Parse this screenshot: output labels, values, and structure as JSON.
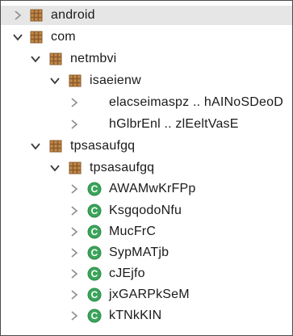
{
  "tree": {
    "nodes": [
      {
        "label": "android",
        "kind": "package",
        "state": "collapsed",
        "depth": 0,
        "selected": true
      },
      {
        "label": "com",
        "kind": "package",
        "state": "expanded",
        "depth": 0
      },
      {
        "label": "netmbvi",
        "kind": "package",
        "state": "expanded",
        "depth": 1
      },
      {
        "label": "isaeienw",
        "kind": "package",
        "state": "expanded",
        "depth": 2
      },
      {
        "label": "elacseimaspz .. hAINoSDeoD",
        "kind": "folder",
        "state": "collapsed",
        "depth": 3
      },
      {
        "label": "hGlbrEnl .. zlEeltVasE",
        "kind": "folder",
        "state": "collapsed",
        "depth": 3
      },
      {
        "label": "tpsasaufgq",
        "kind": "package",
        "state": "expanded",
        "depth": 1
      },
      {
        "label": "tpsasaufgq",
        "kind": "package",
        "state": "expanded",
        "depth": 2
      },
      {
        "label": "AWAMwKrFPp",
        "kind": "class",
        "state": "collapsed",
        "depth": 3
      },
      {
        "label": "KsgqodoNfu",
        "kind": "class",
        "state": "collapsed",
        "depth": 3
      },
      {
        "label": "MucFrC",
        "kind": "class",
        "state": "collapsed",
        "depth": 3
      },
      {
        "label": "SypMATjb",
        "kind": "class",
        "state": "collapsed",
        "depth": 3
      },
      {
        "label": "cJEjfo",
        "kind": "class",
        "state": "collapsed",
        "depth": 3
      },
      {
        "label": "jxGARPkSeM",
        "kind": "class",
        "state": "collapsed",
        "depth": 3
      },
      {
        "label": "kTNkKIN",
        "kind": "class",
        "state": "collapsed",
        "depth": 3
      }
    ]
  },
  "icons": {
    "package_icon": "package-icon",
    "class_icon": "class-icon",
    "expanded_arrow": "chevron-down-icon",
    "collapsed_arrow": "chevron-right-icon"
  },
  "colors": {
    "package_brown": "#8a5a2b",
    "class_green": "#3aa55a",
    "selection": "#e6e6e6",
    "text": "#1a1a1a"
  }
}
